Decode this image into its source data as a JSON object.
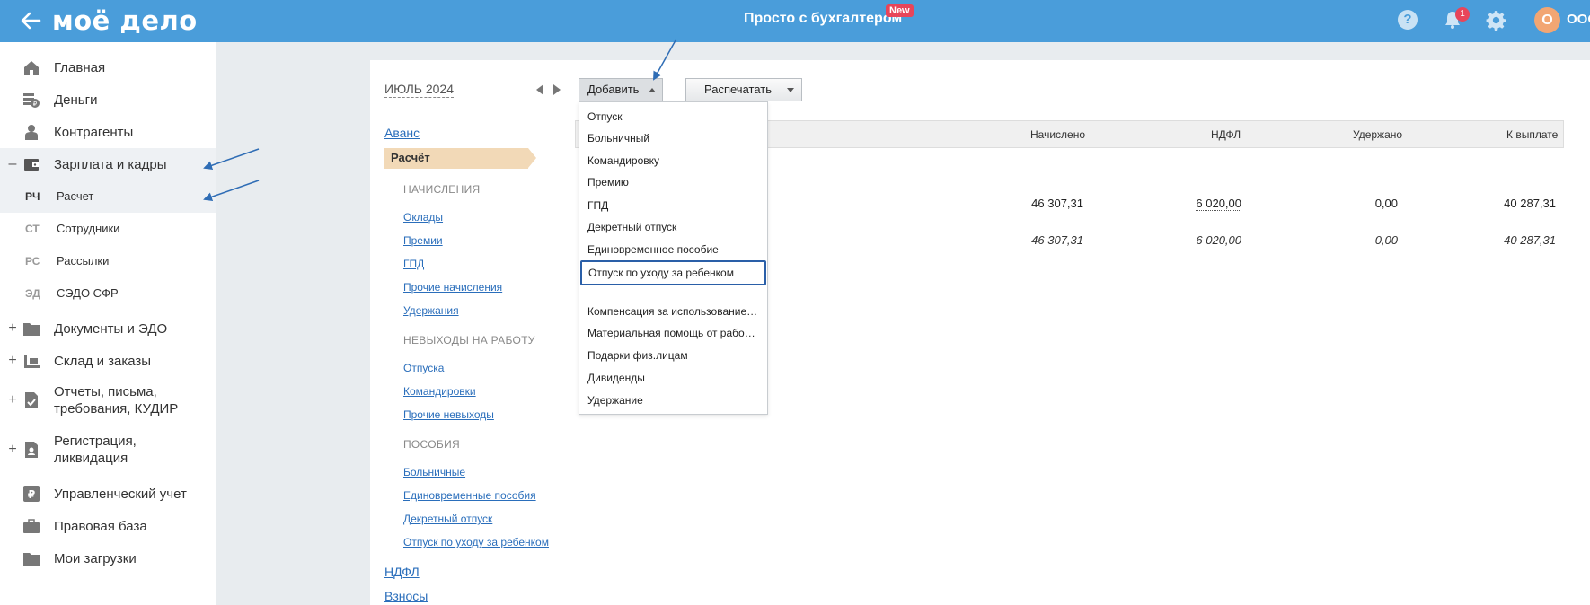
{
  "topbar": {
    "logo": "моё дело",
    "promo": "Просто с бухгалтером",
    "new_badge": "New",
    "notifications_count": "1",
    "avatar_letter": "О",
    "org_name": "ООО"
  },
  "sidebar": {
    "items": [
      {
        "label": "Главная",
        "icon": "home-icon"
      },
      {
        "label": "Деньги",
        "icon": "money-icon"
      },
      {
        "label": "Контрагенты",
        "icon": "contractors-icon"
      },
      {
        "label": "Зарплата и кадры",
        "icon": "wallet-icon",
        "expander": "–"
      },
      {
        "label": "Документы и ЭДО",
        "icon": "folder-icon",
        "expander": "+"
      },
      {
        "label": "Склад и заказы",
        "icon": "warehouse-icon",
        "expander": "+"
      },
      {
        "label": "Отчеты, письма, требования, КУДИР",
        "icon": "report-icon",
        "expander": "+"
      },
      {
        "label": "Регистрация, ликвидация",
        "icon": "registration-icon",
        "expander": "+"
      },
      {
        "label": "Управленческий учет",
        "icon": "management-icon"
      },
      {
        "label": "Правовая база",
        "icon": "briefcase-icon"
      },
      {
        "label": "Мои загрузки",
        "icon": "folder-icon"
      }
    ],
    "subitems": [
      {
        "abbr": "РЧ",
        "label": "Расчет"
      },
      {
        "abbr": "СТ",
        "label": "Сотрудники"
      },
      {
        "abbr": "РС",
        "label": "Рассылки"
      },
      {
        "abbr": "ЭД",
        "label": "СЭДО СФР"
      }
    ]
  },
  "toolbar": {
    "period": "ИЮЛЬ 2024",
    "add_label": "Добавить",
    "print_label": "Распечатать"
  },
  "payroll_nav": {
    "advance": "Аванс",
    "calculation": "Расчёт",
    "accruals_head": "НАЧИСЛЕНИЯ",
    "accruals": [
      "Оклады",
      "Премии",
      "ГПД",
      "Прочие начисления",
      "Удержания"
    ],
    "absences_head": "НЕВЫХОДЫ НА РАБОТУ",
    "absences": [
      "Отпуска",
      "Командировки",
      "Прочие невыходы"
    ],
    "benefits_head": "ПОСОБИЯ",
    "benefits": [
      "Больничные",
      "Единовременные пособия",
      "Декретный отпуск",
      "Отпуск по уходу за ребенком"
    ],
    "ndfl": "НДФЛ",
    "contributions": "Взносы"
  },
  "table": {
    "headers": {
      "accrued": "Начислено",
      "ndfl": "НДФЛ",
      "withheld": "Удержано",
      "payout": "К выплате"
    },
    "rows": [
      {
        "accrued": "46 307,31",
        "ndfl": "6 020,00",
        "withheld": "0,00",
        "payout": "40 287,31"
      },
      {
        "accrued": "46 307,31",
        "ndfl": "6 020,00",
        "withheld": "0,00",
        "payout": "40 287,31"
      }
    ]
  },
  "dropdown": {
    "items": [
      "Отпуск",
      "Больничный",
      "Командировку",
      "Премию",
      "ГПД",
      "Декретный отпуск",
      "Единовременное пособие",
      "Отпуск по уходу за ребенком",
      "Компенсация за использование…",
      "Материальная помощь от рабо…",
      "Подарки физ.лицам",
      "Дивиденды",
      "Удержание"
    ],
    "highlighted_index": 7
  },
  "colors": {
    "topbar": "#4a9dda",
    "link": "#2a6ebb",
    "active_tab": "#f2d9b7",
    "highlight_border": "#2a5fa8",
    "annotation": "#2f6db5"
  }
}
